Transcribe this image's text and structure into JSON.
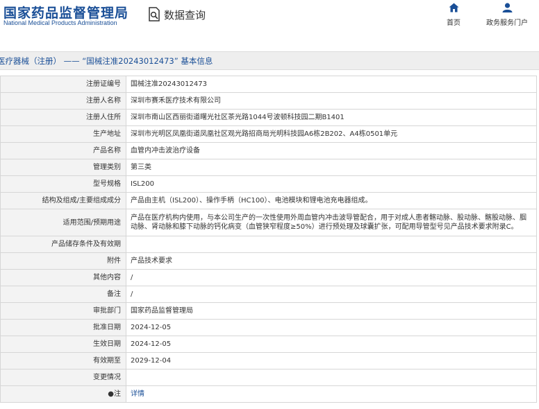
{
  "header": {
    "brand_cn": "国家药品监督管理局",
    "brand_en": "National Medical Products Administration",
    "search_label": "数据查询",
    "nav": [
      {
        "label": "首页",
        "icon": "home-icon"
      },
      {
        "label": "政务服务门户",
        "icon": "user-icon"
      }
    ]
  },
  "title": "医疗器械（注册） —— “国械注准20243012473” 基本信息",
  "rows": [
    {
      "key": "注册证编号",
      "value": "国械注准20243012473"
    },
    {
      "key": "注册人名称",
      "value": "深圳市赛禾医疗技术有限公司"
    },
    {
      "key": "注册人住所",
      "value": "深圳市南山区西丽街道曙光社区茶光路1044号波顿科技园二期B1401"
    },
    {
      "key": "生产地址",
      "value": "深圳市光明区凤凰街道凤凰社区观光路招商局光明科技园A6栋2B202、A4栋0501单元"
    },
    {
      "key": "产品名称",
      "value": "血管内冲击波治疗设备"
    },
    {
      "key": "管理类别",
      "value": "第三类"
    },
    {
      "key": "型号规格",
      "value": "ISL200"
    },
    {
      "key": "结构及组成/主要组成成分",
      "value": "产品由主机（ISL200）、操作手柄（HC100）、电池模块和锂电池充电器组成。"
    },
    {
      "key": "适用范围/预期用途",
      "value": "产品在医疗机构内使用，与本公司生产的一次性使用外周血管内冲击波导管配合，用于对成人患者髂动脉、股动脉、髂股动脉、腘动脉、肾动脉和膝下动脉的钙化病变（血管狭窄程度≥50%）进行预处理及球囊扩张，可配用导管型号见产品技术要求附录C。"
    },
    {
      "key": "产品储存条件及有效期",
      "value": ""
    },
    {
      "key": "附件",
      "value": "产品技术要求"
    },
    {
      "key": "其他内容",
      "value": "/"
    },
    {
      "key": "备注",
      "value": "/"
    },
    {
      "key": "审批部门",
      "value": "国家药品监督管理局"
    },
    {
      "key": "批准日期",
      "value": "2024-12-05"
    },
    {
      "key": "生效日期",
      "value": "2024-12-05"
    },
    {
      "key": "有效期至",
      "value": "2029-12-04"
    },
    {
      "key": "变更情况",
      "value": ""
    },
    {
      "key": "●注",
      "value": "详情",
      "link": true
    }
  ],
  "colors": {
    "brand": "#1a4f97",
    "key_bg": "#f3f3f3",
    "border": "#d6d6d6"
  }
}
